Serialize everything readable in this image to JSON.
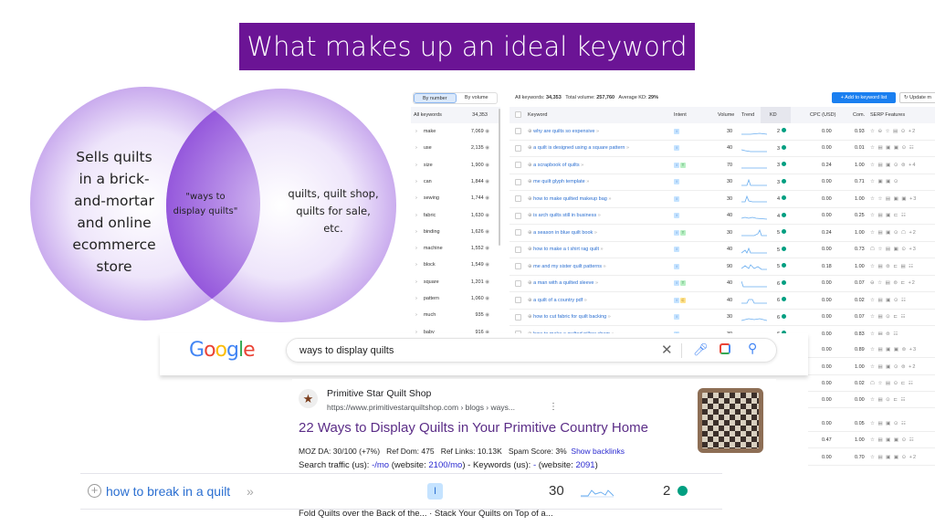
{
  "slide": {
    "title": "What makes up an ideal keyword"
  },
  "venn": {
    "left": "Sells quilts in a brick-and-mortar and online ecommerce store",
    "left_lines": [
      "Sells quilts",
      "in a brick-",
      "and-mortar",
      "and online",
      "ecommerce",
      "store"
    ],
    "overlap_lines": [
      "\"ways to",
      "display quilts\""
    ],
    "right_lines": [
      "quilts, quilt shop,",
      "quilts for sale,",
      "etc."
    ],
    "color": "#9b5fe0"
  },
  "semrush": {
    "toggle": [
      "By number",
      "By volume"
    ],
    "summary": {
      "all_label": "All keywords:",
      "all": "34,353",
      "vol_label": "Total volume:",
      "vol": "257,760",
      "kd_label": "Average KD:",
      "kd": "29%"
    },
    "add_button": "+ Add to keyword list",
    "update_button": "Update m",
    "sidebar_header": {
      "label": "All keywords",
      "count": "34,353"
    },
    "sidebar": [
      {
        "w": "make",
        "n": "7,069"
      },
      {
        "w": "use",
        "n": "2,135"
      },
      {
        "w": "size",
        "n": "1,900"
      },
      {
        "w": "can",
        "n": "1,844"
      },
      {
        "w": "sewing",
        "n": "1,744"
      },
      {
        "w": "fabric",
        "n": "1,630"
      },
      {
        "w": "binding",
        "n": "1,626"
      },
      {
        "w": "machine",
        "n": "1,552"
      },
      {
        "w": "block",
        "n": "1,549"
      },
      {
        "w": "square",
        "n": "1,201"
      },
      {
        "w": "pattern",
        "n": "1,060"
      },
      {
        "w": "much",
        "n": "935"
      },
      {
        "w": "baby",
        "n": "916"
      }
    ],
    "columns": [
      "Keyword",
      "Intent",
      "Volume",
      "Trend",
      "KD",
      "CPC (USD)",
      "Com.",
      "SERP Features"
    ],
    "rows": [
      {
        "kw": "why are quilts so expensive",
        "intent": [
          "I"
        ],
        "vol": "30",
        "kd": "2",
        "cpc": "0.00",
        "com": "0.93",
        "serp": "☆ ⊖ ☆ ▤ ⊙ +2"
      },
      {
        "kw": "a quilt is designed using a square pattern",
        "intent": [
          "I"
        ],
        "vol": "40",
        "kd": "3",
        "cpc": "0.00",
        "com": "0.01",
        "serp": "☆ ▤ ▣ ▣ ⊙ ☷"
      },
      {
        "kw": "a scrapbook of quilts",
        "intent": [
          "I",
          "T"
        ],
        "vol": "70",
        "kd": "3",
        "cpc": "0.24",
        "com": "1.00",
        "serp": "☆ ▤ ▣ ⊙ ⊜ +4"
      },
      {
        "kw": "me quilt glyph template",
        "intent": [
          "I"
        ],
        "vol": "30",
        "kd": "3",
        "cpc": "0.00",
        "com": "0.71",
        "serp": "☆ ▣ ▣ ⊙"
      },
      {
        "kw": "how to make quilted makeup bag",
        "intent": [
          "I"
        ],
        "vol": "30",
        "kd": "4",
        "cpc": "0.00",
        "com": "1.00",
        "serp": "☆ ☆ ▤ ▣ ▣ +3"
      },
      {
        "kw": "is arch quilts still in business",
        "intent": [
          "I"
        ],
        "vol": "40",
        "kd": "4",
        "cpc": "0.00",
        "com": "0.25",
        "serp": "☆ ▤ ▣ ⊏ ☷"
      },
      {
        "kw": "a season in blue quilt book",
        "intent": [
          "I",
          "T"
        ],
        "vol": "30",
        "kd": "5",
        "cpc": "0.24",
        "com": "1.00",
        "serp": "☆ ▤ ▣ ⊙ ☖ +2"
      },
      {
        "kw": "how to make a t shirt rag quilt",
        "intent": [
          "I"
        ],
        "vol": "40",
        "kd": "5",
        "cpc": "0.00",
        "com": "0.73",
        "serp": "☖ ☆ ▤ ▣ ⊙ +3"
      },
      {
        "kw": "me and my sister quilt patterns",
        "intent": [
          "I"
        ],
        "vol": "90",
        "kd": "5",
        "cpc": "0.18",
        "com": "1.00",
        "serp": "☆ ▤ ⊜ ⊏ ▤ ☷"
      },
      {
        "kw": "a man with a quilted sleeve",
        "intent": [
          "I",
          "T"
        ],
        "vol": "40",
        "kd": "6",
        "cpc": "0.00",
        "com": "0.07",
        "serp": "⊖ ☆ ▤ ⊜ ⊏ +2"
      },
      {
        "kw": "a quilt of a country pdf",
        "intent": [
          "I",
          "C"
        ],
        "vol": "40",
        "kd": "6",
        "cpc": "0.00",
        "com": "0.02",
        "serp": "☆ ▤ ▣ ⊙ ☷"
      },
      {
        "kw": "how to cut fabric for quilt backing",
        "intent": [
          "I"
        ],
        "vol": "30",
        "kd": "6",
        "cpc": "0.00",
        "com": "0.07",
        "serp": "☆ ▤ ⊙ ⊏ ☷"
      },
      {
        "kw": "how to make a quilted pillow sham",
        "intent": [
          "I"
        ],
        "vol": "30",
        "kd": "6",
        "cpc": "0.00",
        "com": "0.83",
        "serp": "☆ ▤ ⊜ ☷"
      }
    ],
    "partial_rows": [
      {
        "cpc": "0.00",
        "com": "0.89",
        "serp": "☆ ▤ ▣ ▣ ⊜ +3"
      },
      {
        "cpc": "0.00",
        "com": "1.00",
        "serp": "☆ ▤ ▣ ⊙ ⊜ +2"
      },
      {
        "cpc": "0.00",
        "com": "0.02",
        "serp": "☖ ☆ ▤ ⊙ ⊏ ☷"
      },
      {
        "cpc": "0.00",
        "com": "0.00",
        "serp": "☆ ▤ ⊙ ⊏ ☷"
      },
      {
        "cpc": "0.00",
        "com": "0.05",
        "serp": "☆ ▤ ▣ ⊙ ☷"
      },
      {
        "cpc": "0.47",
        "com": "1.00",
        "serp": "☆ ▤ ▣ ▣ ⊙ ☷"
      },
      {
        "cpc": "0.00",
        "com": "0.70",
        "serp": "☆ ▤ ▣ ▣ ⊙ +2"
      }
    ],
    "kd_color": "#009f81",
    "link_color": "#2b6fd1"
  },
  "google": {
    "logo": "Google",
    "query": "ways to display quilts",
    "result": {
      "site": "Primitive Star Quilt Shop",
      "url": "https://www.primitivestarquiltshop.com › blogs › ways...",
      "title": "22 Ways to Display Quilts in Your Primitive Country Home",
      "moz": "MOZ DA: 30/100 (+7%)",
      "refdom": "Ref Dom: 475",
      "reflinks": "Ref Links: 10.13K",
      "spam": "Spam Score: 3%",
      "backlinks": "Show backlinks",
      "traffic_pre": "Search traffic (us): ",
      "traffic_val": "-/mo",
      "traffic_mid": " (website: ",
      "traffic_site": "2100/mo",
      "traffic_kw": ") - Keywords (us): ",
      "kw_val": "-",
      "kw_mid": " (website: ",
      "kw_site": "2091",
      "kw_end": ")",
      "snippet": "Fold Quilts over the Back of the... · Stack Your Quilts on Top of a..."
    }
  },
  "highlight_row": {
    "kw": "how to break in a quilt",
    "intent": "I",
    "vol": "30",
    "kd": "2"
  }
}
